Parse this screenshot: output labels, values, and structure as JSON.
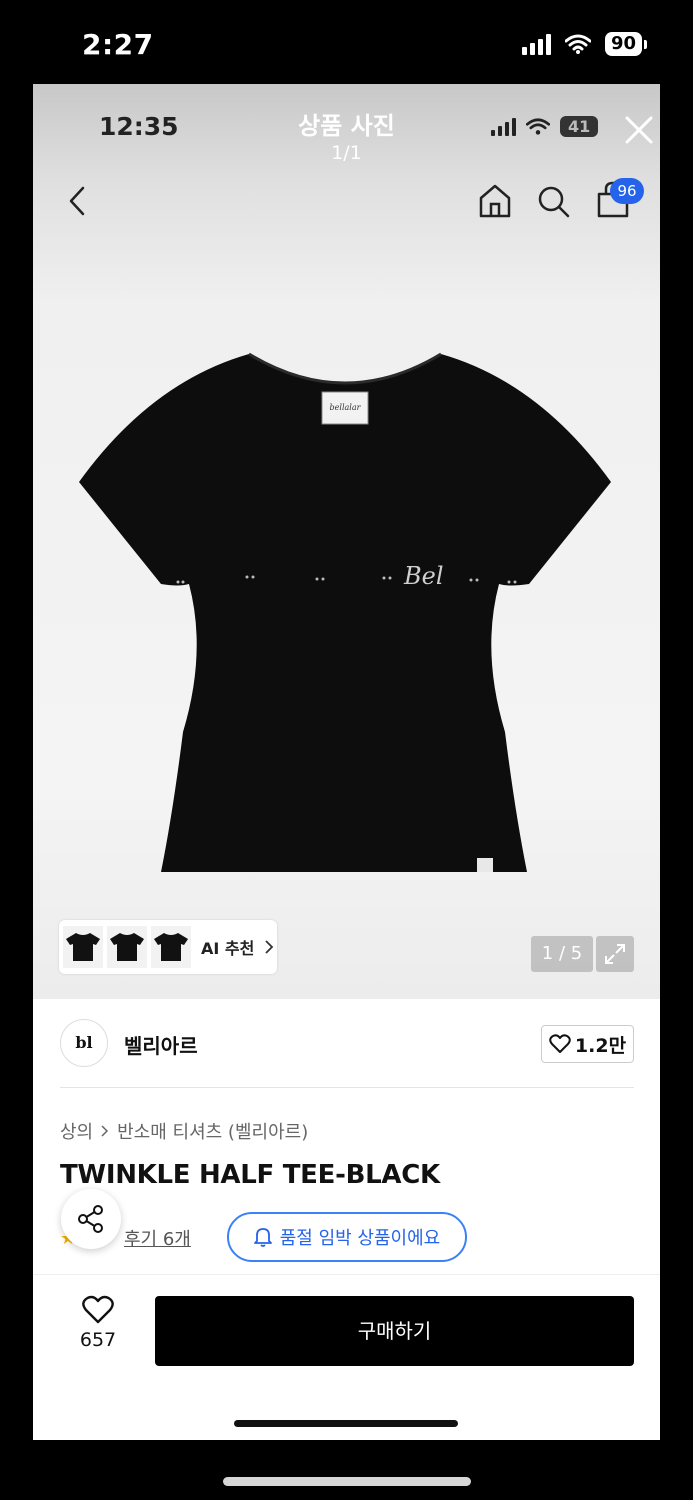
{
  "outer_status": {
    "time": "2:27",
    "battery": "90"
  },
  "viewer": {
    "time": "12:35",
    "title": "상품 사진",
    "counter": "1/1",
    "battery": "41"
  },
  "header": {
    "cart_badge": "96"
  },
  "thumbnails": {
    "ai_label": "AI 추천"
  },
  "gallery": {
    "page_indicator": "1 / 5"
  },
  "brand": {
    "logo_text": "bl",
    "name": "벨리아르",
    "likes": "1.2만"
  },
  "breadcrumb": {
    "category": "상의",
    "subcategory": "반소매 티셔츠 (벨리아르)"
  },
  "product": {
    "name": "TWINKLE HALF TEE-BLACK",
    "reviews": "후기 6개",
    "soldout_notice": "품절 임박 상품이에요"
  },
  "bottom": {
    "wish_count": "657",
    "buy_label": "구매하기"
  },
  "shirt": {
    "script_text": "Bel"
  },
  "colors": {
    "accent_blue": "#2563eb",
    "buy_button": "#000000"
  },
  "icons": [
    "back-icon",
    "home-icon",
    "search-icon",
    "bag-icon",
    "close-icon",
    "expand-icon",
    "heart-icon",
    "share-icon",
    "bell-icon",
    "chevron-right-icon",
    "star-icon"
  ]
}
